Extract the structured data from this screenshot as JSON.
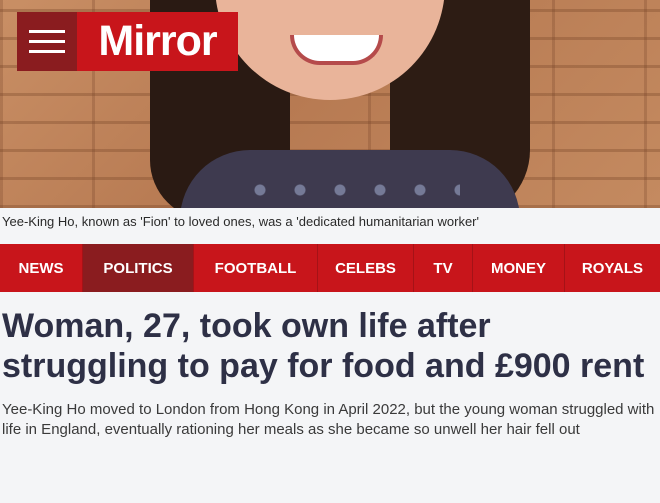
{
  "header": {
    "brand": "Mirror",
    "menu_icon": "hamburger-icon",
    "brand_color": "#c8151b",
    "menu_color": "#8a1c1f"
  },
  "image": {
    "caption": "Yee-King Ho, known as 'Fion' to loved ones, was a 'dedicated humanitarian worker'"
  },
  "nav": {
    "items": [
      {
        "label": "NEWS",
        "active": false
      },
      {
        "label": "POLITICS",
        "active": true
      },
      {
        "label": "FOOTBALL",
        "active": false
      },
      {
        "label": "CELEBS",
        "active": false
      },
      {
        "label": "TV",
        "active": false
      },
      {
        "label": "MONEY",
        "active": false
      },
      {
        "label": "ROYALS",
        "active": false
      }
    ]
  },
  "article": {
    "headline": "Woman, 27, took own life after struggling to pay for food and £900 rent",
    "standfirst": "Yee-King Ho moved to London from Hong Kong in April 2022, but the young woman struggled with life in England, eventually rationing her meals as she became so unwell her hair fell out"
  }
}
